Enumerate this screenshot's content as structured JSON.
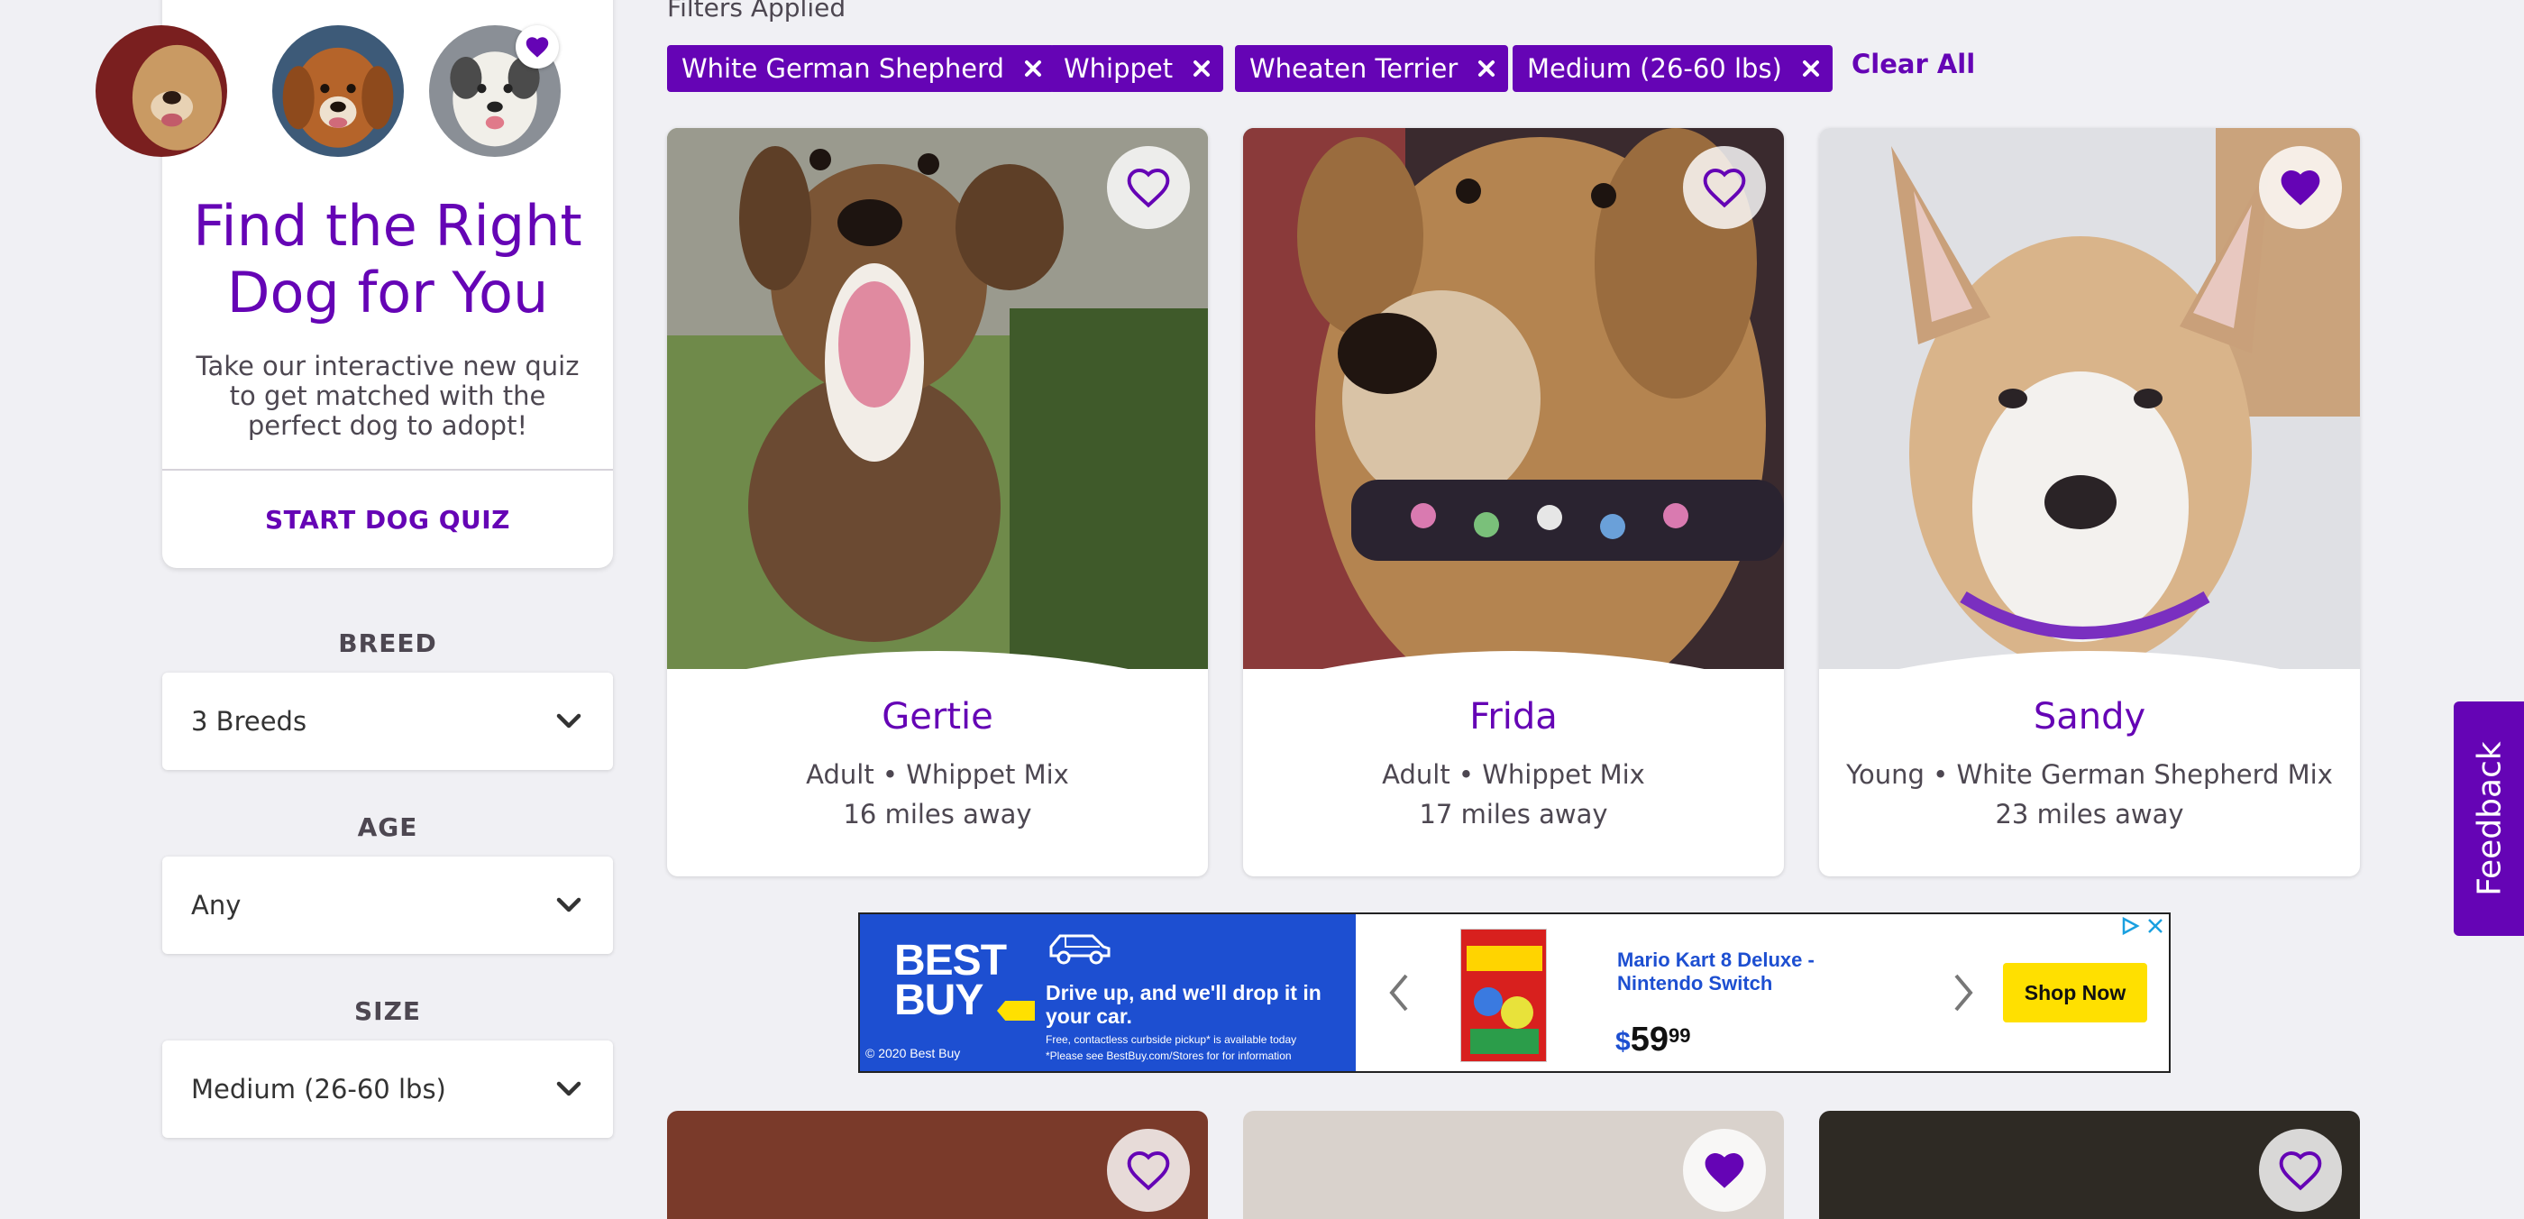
{
  "colors": {
    "brand_purple": "#6504b5",
    "page_bg": "#f0f0f4",
    "text_gray": "#4d4751",
    "bestbuy_blue": "#1d4fd1",
    "bestbuy_yellow": "#ffe000"
  },
  "sidebar": {
    "quiz": {
      "title": "Find the Right Dog for You",
      "description": "Take our interactive new quiz to get matched with the perfect dog to adopt!",
      "button_label": "START DOG QUIZ",
      "avatar_count": 3
    },
    "filters": [
      {
        "label": "BREED",
        "value": "3 Breeds"
      },
      {
        "label": "AGE",
        "value": "Any"
      },
      {
        "label": "SIZE",
        "value": "Medium (26-60 lbs)"
      }
    ]
  },
  "filters_applied": {
    "heading": "Filters Applied",
    "chips": [
      "White German Shepherd",
      "Whippet",
      "Wheaten Terrier",
      "Medium (26-60 lbs)"
    ],
    "clear_all_label": "Clear All"
  },
  "pets": [
    {
      "name": "Gertie",
      "age": "Adult",
      "breed": "Whippet Mix",
      "distance": "16 miles away",
      "favorited": false
    },
    {
      "name": "Frida",
      "age": "Adult",
      "breed": "Whippet Mix",
      "distance": "17 miles away",
      "favorited": false
    },
    {
      "name": "Sandy",
      "age": "Young",
      "breed": "White German Shepherd Mix",
      "distance": "23 miles away",
      "favorited": true
    }
  ],
  "ad": {
    "brand_line1": "BEST",
    "brand_line2": "BUY",
    "copyright": "© 2020 Best Buy",
    "headline": "Drive up, and we'll drop it in your car.",
    "fine_print_1": "Free, contactless curbside pickup* is available today",
    "fine_print_2": "*Please see BestBuy.com/Stores for for information",
    "product_name": "Mario Kart 8 Deluxe - Nintendo Switch",
    "price_currency": "$",
    "price_whole": "59",
    "price_cents": "99",
    "cta": "Shop Now"
  },
  "feedback_label": "Feedback",
  "icons": [
    "heart-outline-icon",
    "heart-filled-icon",
    "chevron-down-icon",
    "close-icon",
    "car-icon",
    "adchoices-icon",
    "chevron-left-icon",
    "chevron-right-icon"
  ]
}
